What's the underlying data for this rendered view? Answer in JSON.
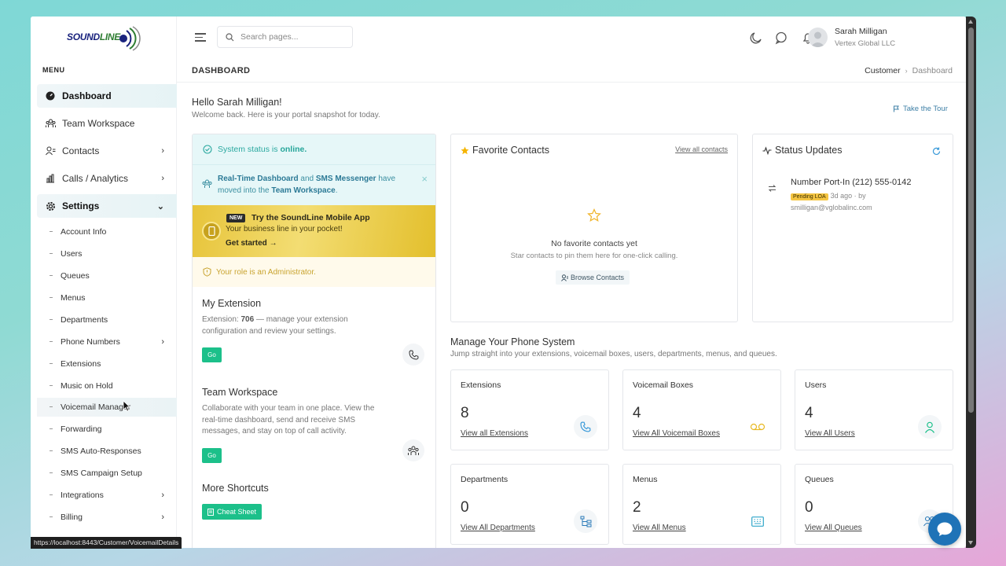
{
  "brand": {
    "logo_text_a": "SOUND",
    "logo_text_b": "LINE",
    "accent": "#1cc08a",
    "primary": "#1f73b7"
  },
  "sidebar": {
    "menu_label": "MENU",
    "items": [
      {
        "label": "Dashboard",
        "icon": "dashboard-icon"
      },
      {
        "label": "Team Workspace",
        "icon": "team-icon"
      },
      {
        "label": "Contacts",
        "icon": "contacts-icon"
      },
      {
        "label": "Calls / Analytics",
        "icon": "analytics-icon"
      },
      {
        "label": "Settings",
        "icon": "gear-icon"
      }
    ],
    "sub_items": [
      {
        "label": "Account Info"
      },
      {
        "label": "Users"
      },
      {
        "label": "Queues"
      },
      {
        "label": "Menus"
      },
      {
        "label": "Departments"
      },
      {
        "label": "Phone Numbers"
      },
      {
        "label": "Extensions"
      },
      {
        "label": "Music on Hold"
      },
      {
        "label": "Voicemail Manager"
      },
      {
        "label": "Forwarding"
      },
      {
        "label": "SMS Auto-Responses"
      },
      {
        "label": "SMS Campaign Setup"
      },
      {
        "label": "Integrations"
      },
      {
        "label": "Billing"
      }
    ]
  },
  "topbar": {
    "search_placeholder": "Search pages...",
    "user_name": "Sarah Milligan",
    "user_org": "Vertex Global LLC"
  },
  "page": {
    "title": "DASHBOARD",
    "breadcrumb_root": "Customer",
    "breadcrumb_sep": "›",
    "breadcrumb_current": "Dashboard",
    "hello": "Hello Sarah Milligan!",
    "welcome": "Welcome back. Here is your portal snapshot for today.",
    "tour": "Take the Tour"
  },
  "left_panel": {
    "status_prefix": "System status is",
    "status_value": "online.",
    "notice_part1": "Real-Time Dashboard",
    "notice_and": " and ",
    "notice_part2": "SMS Messenger",
    "notice_rest": " have moved into the ",
    "notice_part3": "Team Workspace",
    "notice_end": ".",
    "notice_close": "×",
    "promo_badge": "NEW",
    "promo_title": "Try the SoundLine Mobile App",
    "promo_sub": "Your business line in your pocket!",
    "promo_link": "Get started →",
    "role_text": "Your role is an Administrator.",
    "ext_title": "My Extension",
    "ext_desc_pre": "Extension: ",
    "ext_number": "706",
    "ext_desc_post": " — manage your extension configuration and review your settings.",
    "go_label": "Go",
    "team_title": "Team Workspace",
    "team_desc": "Collaborate with your team in one place. View the real-time dashboard, send and receive SMS messages, and stay on top of call activity.",
    "shortcuts_title": "More Shortcuts",
    "cheat_label": "Cheat Sheet"
  },
  "favorites": {
    "title": "Favorite Contacts",
    "view_all": "View all contacts",
    "empty_title": "No favorite contacts yet",
    "empty_sub": "Star contacts to pin them here for one-click calling.",
    "browse": "Browse Contacts"
  },
  "status_updates": {
    "title": "Status Updates",
    "item_title": "Number Port-In (212) 555-0142",
    "item_badge": "Pending LOA",
    "item_meta": "3d ago · by",
    "item_email": "smilligan@vglobalinc.com"
  },
  "manage": {
    "title": "Manage Your Phone System",
    "subtitle": "Jump straight into your extensions, voicemail boxes, users, departments, menus, and queues.",
    "tiles": [
      {
        "label": "Extensions",
        "count": "8",
        "link": "View all Extensions",
        "icon": "phone-icon",
        "color": "#3a9ad9"
      },
      {
        "label": "Voicemail Boxes",
        "count": "4",
        "link": "View All Voicemail Boxes",
        "icon": "voicemail-icon",
        "color": "#e8b923"
      },
      {
        "label": "Users",
        "count": "4",
        "link": "View All Users",
        "icon": "user-icon",
        "color": "#1cc08a"
      },
      {
        "label": "Departments",
        "count": "0",
        "link": "View All Departments",
        "icon": "hierarchy-icon",
        "color": "#2b7bb9"
      },
      {
        "label": "Menus",
        "count": "2",
        "link": "View All Menus",
        "icon": "keypad-icon",
        "color": "#2fa6c9"
      },
      {
        "label": "Queues",
        "count": "0",
        "link": "View All Queues",
        "icon": "queue-users-icon",
        "color": "#2b7bb9"
      }
    ]
  },
  "status_bar_url": "https://localhost:8443/Customer/VoicemailDetails"
}
